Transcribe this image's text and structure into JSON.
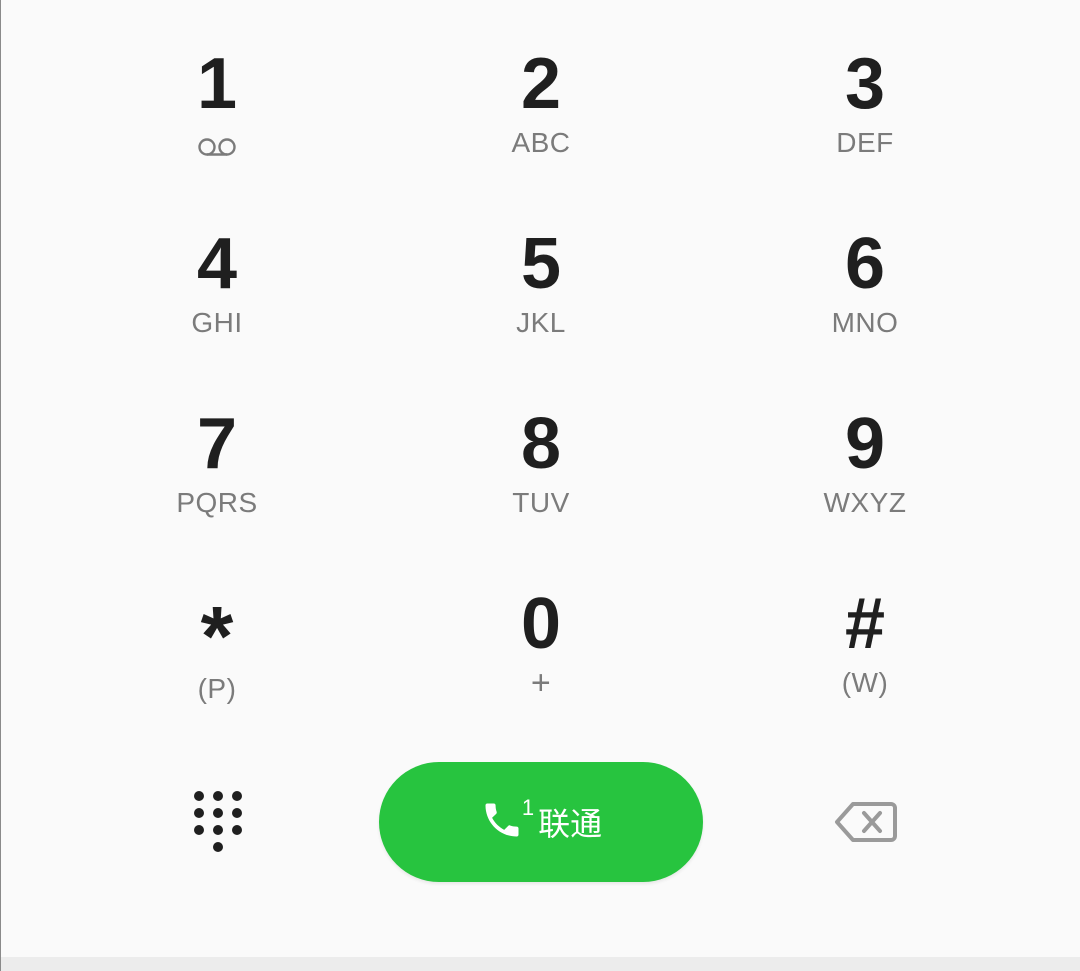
{
  "keypad": {
    "keys": [
      {
        "digit": "1",
        "sub": ""
      },
      {
        "digit": "2",
        "sub": "ABC"
      },
      {
        "digit": "3",
        "sub": "DEF"
      },
      {
        "digit": "4",
        "sub": "GHI"
      },
      {
        "digit": "5",
        "sub": "JKL"
      },
      {
        "digit": "6",
        "sub": "MNO"
      },
      {
        "digit": "7",
        "sub": "PQRS"
      },
      {
        "digit": "8",
        "sub": "TUV"
      },
      {
        "digit": "9",
        "sub": "WXYZ"
      },
      {
        "digit": "*",
        "sub": "(P)"
      },
      {
        "digit": "0",
        "sub": "+"
      },
      {
        "digit": "#",
        "sub": "(W)"
      }
    ],
    "key1_icon": "voicemail-icon"
  },
  "call": {
    "sim_number": "1",
    "label": "联通",
    "color": "#27c43f",
    "icon": "phone-icon"
  },
  "controls": {
    "dialpad_icon": "dialpad-icon",
    "backspace_icon": "backspace-icon"
  }
}
